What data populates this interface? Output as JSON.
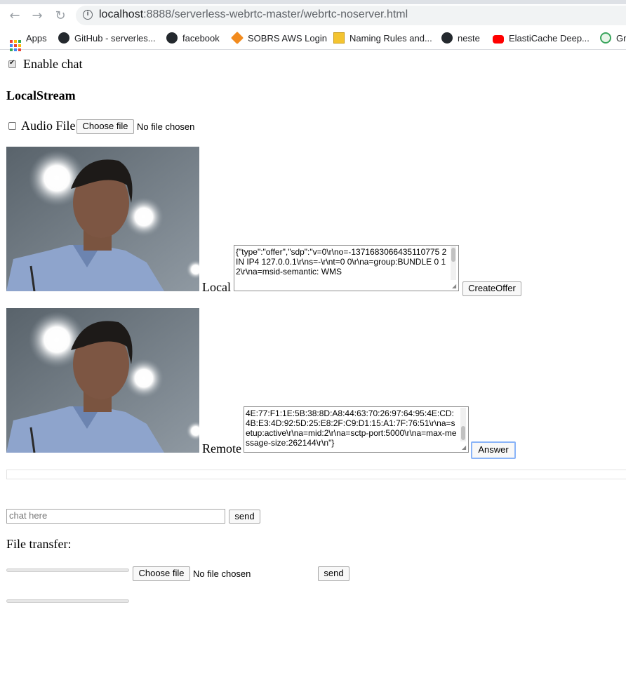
{
  "browser": {
    "url_host": "localhost",
    "url_path": ":8888/serverless-webrtc-master/webrtc-noserver.html",
    "bookmarks": [
      {
        "label": "Apps",
        "icon": "apps-grid-icon"
      },
      {
        "label": "GitHub - serverles...",
        "icon": "github-icon"
      },
      {
        "label": "facebook",
        "icon": "github-icon"
      },
      {
        "label": "SOBRS AWS Login",
        "icon": "aws-icon"
      },
      {
        "label": "Naming Rules and...",
        "icon": "box-icon"
      },
      {
        "label": "neste",
        "icon": "github-icon"
      },
      {
        "label": "ElastiCache Deep...",
        "icon": "youtube-icon"
      },
      {
        "label": "Gr",
        "icon": "grammarly-icon"
      }
    ]
  },
  "page": {
    "enable_chat_label": "Enable chat",
    "enable_chat_checked": true,
    "local_stream_heading": "LocalStream",
    "audio_file_label": "Audio File",
    "audio_file_checked": false,
    "choose_file_label": "Choose file",
    "no_file_text": "No file chosen",
    "local_label": "Local",
    "local_sdp_text": "{\"type\":\"offer\",\"sdp\":\"v=0\\r\\no=-1371683066435110775 2 IN IP4 127.0.0.1\\r\\ns=-\\r\\nt=0 0\\r\\na=group:BUNDLE 0 1 2\\r\\na=msid-semantic: WMS",
    "create_offer_label": "CreateOffer",
    "remote_label": "Remote",
    "remote_sdp_text": "4E:77:F1:1E:5B:38:8D:A8:44:63:70:26:97:64:95:4E:CD:4B:E3:4D:92:5D:25:E8:2F:C9:D1:15:A1:7F:76:51\\r\\na=setup:active\\r\\na=mid:2\\r\\na=sctp-port:5000\\r\\na=max-message-size:262144\\r\\n\"}",
    "answer_label": "Answer",
    "chat_placeholder": "chat here",
    "chat_send_label": "send",
    "file_transfer_label": "File transfer:",
    "file_send_label": "send"
  }
}
